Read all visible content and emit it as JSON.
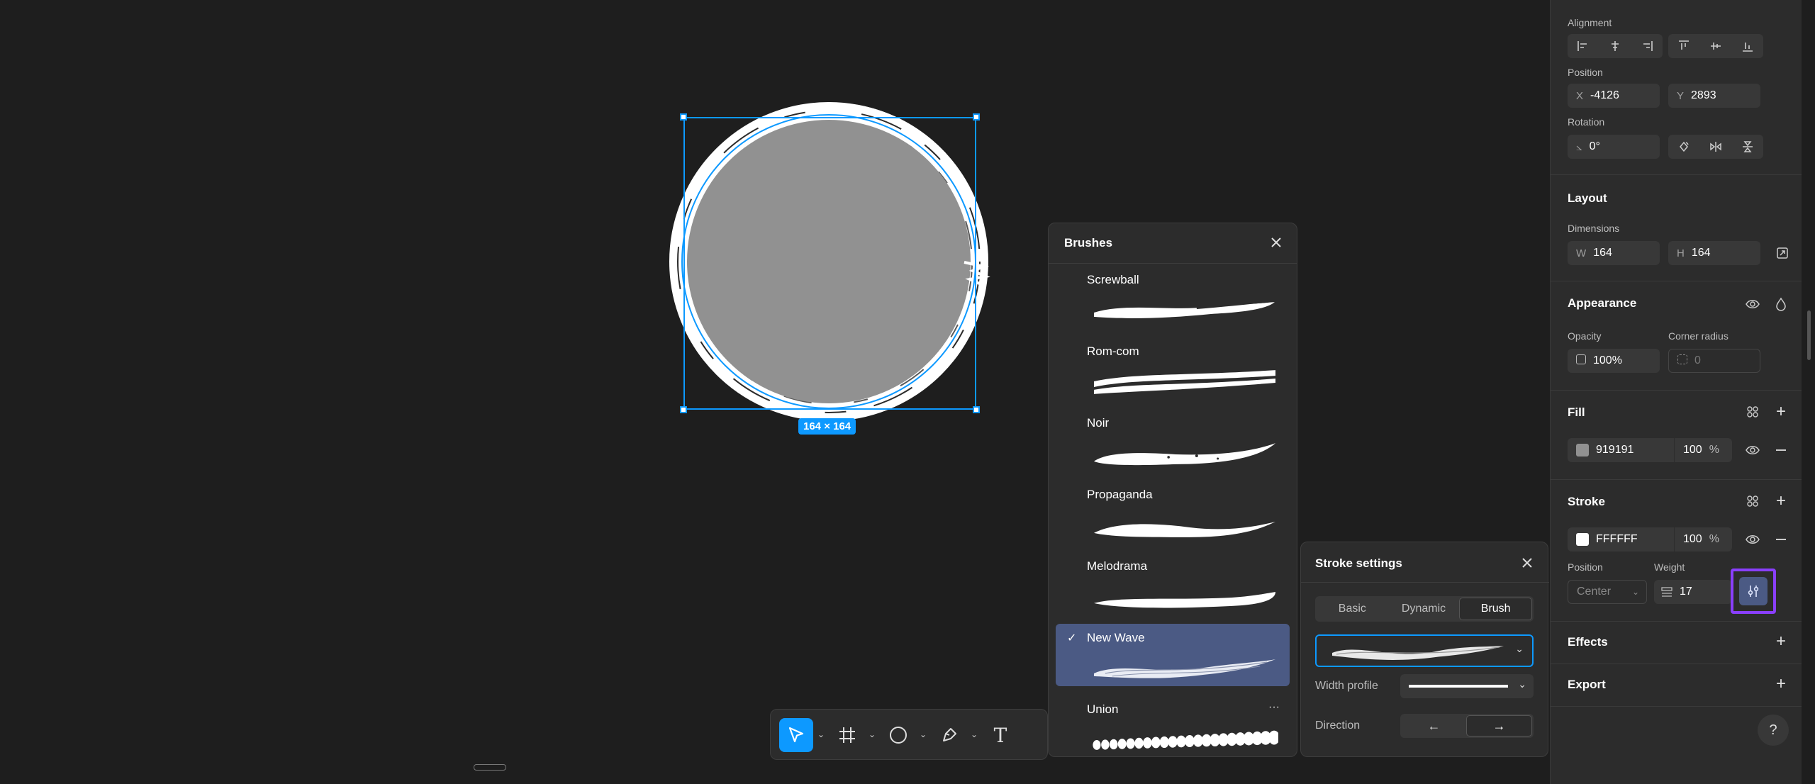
{
  "canvas": {
    "selection_size": "164 × 164",
    "shape_fill": "#919191",
    "stroke_color": "#FFFFFF",
    "selection_color": "#0d99ff"
  },
  "right_panel": {
    "alignment_label": "Alignment",
    "position_label": "Position",
    "pos_x_prefix": "X",
    "pos_x": "-4126",
    "pos_y_prefix": "Y",
    "pos_y": "2893",
    "rotation_label": "Rotation",
    "rotation_prefix": "⦣",
    "rotation": "0°",
    "layout_title": "Layout",
    "dimensions_label": "Dimensions",
    "w_prefix": "W",
    "w": "164",
    "h_prefix": "H",
    "h": "164",
    "appearance_title": "Appearance",
    "opacity_label": "Opacity",
    "opacity": "100%",
    "corner_radius_label": "Corner radius",
    "corner_radius": "0",
    "fill_title": "Fill",
    "fill_hex": "919191",
    "fill_opacity": "100",
    "fill_pct": "%",
    "stroke_title": "Stroke",
    "stroke_hex": "FFFFFF",
    "stroke_opacity": "100",
    "stroke_pct": "%",
    "stroke_position_label": "Position",
    "stroke_position": "Center",
    "weight_label": "Weight",
    "weight": "17",
    "effects_title": "Effects",
    "export_title": "Export",
    "help": "?"
  },
  "brushes": {
    "title": "Brushes",
    "items": [
      {
        "name": "Screwball"
      },
      {
        "name": "Rom-com"
      },
      {
        "name": "Noir"
      },
      {
        "name": "Propaganda"
      },
      {
        "name": "Melodrama"
      },
      {
        "name": "New Wave",
        "selected": true
      },
      {
        "name": "Union"
      }
    ],
    "more": "···",
    "check": "✓"
  },
  "stroke_settings": {
    "title": "Stroke settings",
    "tabs": [
      "Basic",
      "Dynamic",
      "Brush"
    ],
    "active_tab": "Brush",
    "width_profile_label": "Width profile",
    "direction_label": "Direction",
    "dir_left": "←",
    "dir_right": "→"
  },
  "toolbar": {
    "text_tool_glyph": "T"
  }
}
